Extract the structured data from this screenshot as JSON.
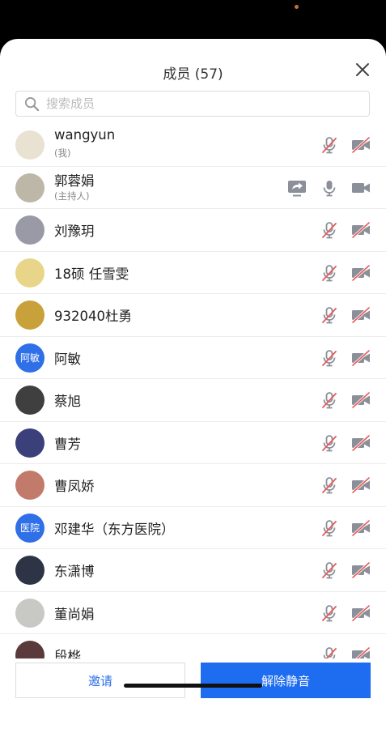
{
  "header": {
    "title": "成员 (57)"
  },
  "search": {
    "placeholder": "搜索成员"
  },
  "members": [
    {
      "name": "wangyun",
      "sub": "(我)",
      "avatar": "photo",
      "avatar_bg": "#e9e2d3",
      "mic": "muted",
      "cam": "off"
    },
    {
      "name": "郭蓉娟",
      "sub": "(主持人)",
      "avatar": "photo",
      "avatar_bg": "#bdb7a8",
      "mic": "on",
      "cam": "on",
      "screen_share": true
    },
    {
      "name": "刘豫玥",
      "avatar": "photo",
      "avatar_bg": "#9a9aa6",
      "mic": "muted",
      "cam": "off"
    },
    {
      "name": "18硕 任雪雯",
      "avatar": "photo",
      "avatar_bg": "#e8d58a",
      "mic": "muted",
      "cam": "off"
    },
    {
      "name": "932040杜勇",
      "avatar": "photo",
      "avatar_bg": "#c9a13b",
      "mic": "muted",
      "cam": "off"
    },
    {
      "name": "阿敏",
      "avatar": "text",
      "avatar_text": "阿敏",
      "avatar_bg": "#2f6fe7",
      "mic": "muted",
      "cam": "off"
    },
    {
      "name": "蔡旭",
      "avatar": "photo",
      "avatar_bg": "#3f3f3f",
      "mic": "muted",
      "cam": "off"
    },
    {
      "name": "曹芳",
      "avatar": "photo",
      "avatar_bg": "#3b3f7a",
      "mic": "muted",
      "cam": "off"
    },
    {
      "name": "曹凤娇",
      "avatar": "photo",
      "avatar_bg": "#c27b6b",
      "mic": "muted",
      "cam": "off"
    },
    {
      "name": "邓建华（东方医院）",
      "avatar": "text",
      "avatar_text": "医院",
      "avatar_bg": "#2f6fe7",
      "mic": "muted",
      "cam": "off"
    },
    {
      "name": "东潇博",
      "avatar": "photo",
      "avatar_bg": "#2c3446",
      "mic": "muted",
      "cam": "off"
    },
    {
      "name": "董尚娟",
      "avatar": "photo",
      "avatar_bg": "#c8c8c4",
      "mic": "muted",
      "cam": "off"
    },
    {
      "name": "段桦",
      "avatar": "photo",
      "avatar_bg": "#5a3a3a",
      "mic": "muted",
      "cam": "off"
    }
  ],
  "footer": {
    "invite_label": "邀请",
    "unmute_label": "解除静音"
  },
  "colors": {
    "accent": "#1e6cf0",
    "muted_red": "#e85a5a",
    "icon_gray": "#8a8f99"
  }
}
